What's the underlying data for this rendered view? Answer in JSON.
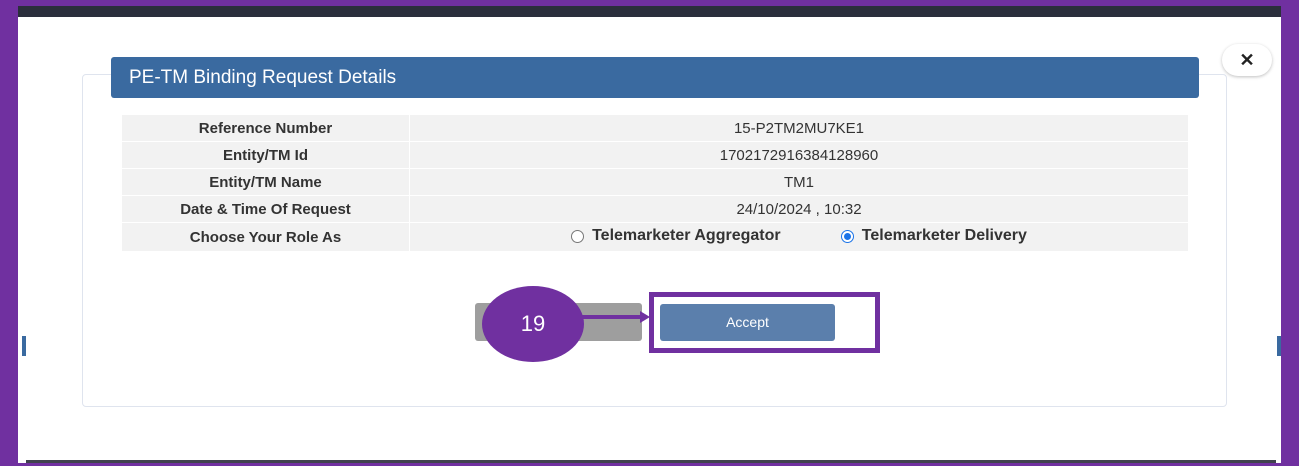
{
  "dialog": {
    "title": "PE-TM Binding Request Details",
    "close_icon": "close-icon",
    "close_symbol": "✕"
  },
  "details": {
    "rows": [
      {
        "label": "Reference Number",
        "value": "15-P2TM2MU7KE1"
      },
      {
        "label": "Entity/TM Id",
        "value": "1702172916384128960"
      },
      {
        "label": "Entity/TM Name",
        "value": "TM1"
      },
      {
        "label": "Date & Time Of Request",
        "value": "24/10/2024 , 10:32"
      }
    ],
    "role": {
      "label": "Choose Your Role As",
      "options": [
        {
          "label": "Telemarketer Aggregator",
          "selected": false
        },
        {
          "label": "Telemarketer Delivery",
          "selected": true
        }
      ]
    }
  },
  "actions": {
    "accept_label": "Accept"
  },
  "annotation": {
    "step_number": "19",
    "color": "#7030a0"
  },
  "colors": {
    "header": "#3a6aa0",
    "accept_button": "#5b7fac",
    "radio_selected": "#1a73e8"
  }
}
